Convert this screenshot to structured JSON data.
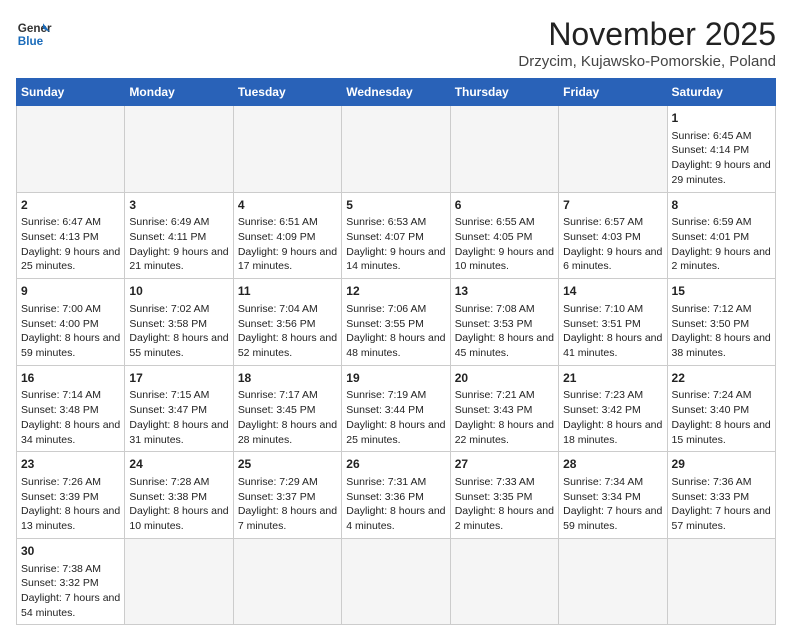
{
  "header": {
    "logo_line1": "General",
    "logo_line2": "Blue",
    "month_title": "November 2025",
    "location": "Drzycim, Kujawsko-Pomorskie, Poland"
  },
  "days_of_week": [
    "Sunday",
    "Monday",
    "Tuesday",
    "Wednesday",
    "Thursday",
    "Friday",
    "Saturday"
  ],
  "weeks": [
    [
      {
        "day": "",
        "info": "",
        "empty": true
      },
      {
        "day": "",
        "info": "",
        "empty": true
      },
      {
        "day": "",
        "info": "",
        "empty": true
      },
      {
        "day": "",
        "info": "",
        "empty": true
      },
      {
        "day": "",
        "info": "",
        "empty": true
      },
      {
        "day": "",
        "info": "",
        "empty": true
      },
      {
        "day": "1",
        "info": "Sunrise: 6:45 AM\nSunset: 4:14 PM\nDaylight: 9 hours and 29 minutes.",
        "empty": false
      }
    ],
    [
      {
        "day": "2",
        "info": "Sunrise: 6:47 AM\nSunset: 4:13 PM\nDaylight: 9 hours and 25 minutes.",
        "empty": false
      },
      {
        "day": "3",
        "info": "Sunrise: 6:49 AM\nSunset: 4:11 PM\nDaylight: 9 hours and 21 minutes.",
        "empty": false
      },
      {
        "day": "4",
        "info": "Sunrise: 6:51 AM\nSunset: 4:09 PM\nDaylight: 9 hours and 17 minutes.",
        "empty": false
      },
      {
        "day": "5",
        "info": "Sunrise: 6:53 AM\nSunset: 4:07 PM\nDaylight: 9 hours and 14 minutes.",
        "empty": false
      },
      {
        "day": "6",
        "info": "Sunrise: 6:55 AM\nSunset: 4:05 PM\nDaylight: 9 hours and 10 minutes.",
        "empty": false
      },
      {
        "day": "7",
        "info": "Sunrise: 6:57 AM\nSunset: 4:03 PM\nDaylight: 9 hours and 6 minutes.",
        "empty": false
      },
      {
        "day": "8",
        "info": "Sunrise: 6:59 AM\nSunset: 4:01 PM\nDaylight: 9 hours and 2 minutes.",
        "empty": false
      }
    ],
    [
      {
        "day": "9",
        "info": "Sunrise: 7:00 AM\nSunset: 4:00 PM\nDaylight: 8 hours and 59 minutes.",
        "empty": false
      },
      {
        "day": "10",
        "info": "Sunrise: 7:02 AM\nSunset: 3:58 PM\nDaylight: 8 hours and 55 minutes.",
        "empty": false
      },
      {
        "day": "11",
        "info": "Sunrise: 7:04 AM\nSunset: 3:56 PM\nDaylight: 8 hours and 52 minutes.",
        "empty": false
      },
      {
        "day": "12",
        "info": "Sunrise: 7:06 AM\nSunset: 3:55 PM\nDaylight: 8 hours and 48 minutes.",
        "empty": false
      },
      {
        "day": "13",
        "info": "Sunrise: 7:08 AM\nSunset: 3:53 PM\nDaylight: 8 hours and 45 minutes.",
        "empty": false
      },
      {
        "day": "14",
        "info": "Sunrise: 7:10 AM\nSunset: 3:51 PM\nDaylight: 8 hours and 41 minutes.",
        "empty": false
      },
      {
        "day": "15",
        "info": "Sunrise: 7:12 AM\nSunset: 3:50 PM\nDaylight: 8 hours and 38 minutes.",
        "empty": false
      }
    ],
    [
      {
        "day": "16",
        "info": "Sunrise: 7:14 AM\nSunset: 3:48 PM\nDaylight: 8 hours and 34 minutes.",
        "empty": false
      },
      {
        "day": "17",
        "info": "Sunrise: 7:15 AM\nSunset: 3:47 PM\nDaylight: 8 hours and 31 minutes.",
        "empty": false
      },
      {
        "day": "18",
        "info": "Sunrise: 7:17 AM\nSunset: 3:45 PM\nDaylight: 8 hours and 28 minutes.",
        "empty": false
      },
      {
        "day": "19",
        "info": "Sunrise: 7:19 AM\nSunset: 3:44 PM\nDaylight: 8 hours and 25 minutes.",
        "empty": false
      },
      {
        "day": "20",
        "info": "Sunrise: 7:21 AM\nSunset: 3:43 PM\nDaylight: 8 hours and 22 minutes.",
        "empty": false
      },
      {
        "day": "21",
        "info": "Sunrise: 7:23 AM\nSunset: 3:42 PM\nDaylight: 8 hours and 18 minutes.",
        "empty": false
      },
      {
        "day": "22",
        "info": "Sunrise: 7:24 AM\nSunset: 3:40 PM\nDaylight: 8 hours and 15 minutes.",
        "empty": false
      }
    ],
    [
      {
        "day": "23",
        "info": "Sunrise: 7:26 AM\nSunset: 3:39 PM\nDaylight: 8 hours and 13 minutes.",
        "empty": false
      },
      {
        "day": "24",
        "info": "Sunrise: 7:28 AM\nSunset: 3:38 PM\nDaylight: 8 hours and 10 minutes.",
        "empty": false
      },
      {
        "day": "25",
        "info": "Sunrise: 7:29 AM\nSunset: 3:37 PM\nDaylight: 8 hours and 7 minutes.",
        "empty": false
      },
      {
        "day": "26",
        "info": "Sunrise: 7:31 AM\nSunset: 3:36 PM\nDaylight: 8 hours and 4 minutes.",
        "empty": false
      },
      {
        "day": "27",
        "info": "Sunrise: 7:33 AM\nSunset: 3:35 PM\nDaylight: 8 hours and 2 minutes.",
        "empty": false
      },
      {
        "day": "28",
        "info": "Sunrise: 7:34 AM\nSunset: 3:34 PM\nDaylight: 7 hours and 59 minutes.",
        "empty": false
      },
      {
        "day": "29",
        "info": "Sunrise: 7:36 AM\nSunset: 3:33 PM\nDaylight: 7 hours and 57 minutes.",
        "empty": false
      }
    ],
    [
      {
        "day": "30",
        "info": "Sunrise: 7:38 AM\nSunset: 3:32 PM\nDaylight: 7 hours and 54 minutes.",
        "empty": false
      },
      {
        "day": "",
        "info": "",
        "empty": true
      },
      {
        "day": "",
        "info": "",
        "empty": true
      },
      {
        "day": "",
        "info": "",
        "empty": true
      },
      {
        "day": "",
        "info": "",
        "empty": true
      },
      {
        "day": "",
        "info": "",
        "empty": true
      },
      {
        "day": "",
        "info": "",
        "empty": true
      }
    ]
  ]
}
